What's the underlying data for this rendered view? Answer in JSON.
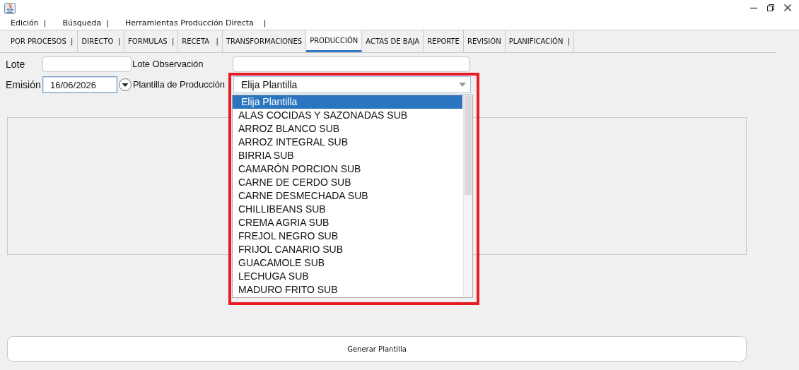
{
  "menu": [
    "Edición  |",
    "Búsqueda  |",
    "Herramientas Producción Directa    |"
  ],
  "tabs": [
    {
      "label": "POR PROCESOS  |",
      "selected": false
    },
    {
      "label": "DIRECTO  |",
      "selected": false
    },
    {
      "label": "FORMULAS  |",
      "selected": false
    },
    {
      "label": "RECETA   |",
      "selected": false
    },
    {
      "label": "TRANSFORMACIONES",
      "selected": false
    },
    {
      "label": "PRODUCCIÓN",
      "selected": true
    },
    {
      "label": "ACTAS DE BAJA",
      "selected": false
    },
    {
      "label": "REPORTE",
      "selected": false
    },
    {
      "label": "REVISIÓN",
      "selected": false
    },
    {
      "label": "PLANIFICACIÓN  |",
      "selected": false
    }
  ],
  "form": {
    "lote_label": "Lote",
    "lote_observacion_label": "Lote Observación",
    "emision_label": "Emisión",
    "emision_value": "16/06/2026",
    "plantilla_label": "Plantilla de Producción",
    "plantilla_value": "Elija Plantilla"
  },
  "dropdown": {
    "highlighted": true,
    "options": [
      {
        "label": "Elija Plantilla",
        "selected": true
      },
      {
        "label": "ALAS COCIDAS Y SAZONADAS SUB",
        "selected": false
      },
      {
        "label": "ARROZ BLANCO SUB",
        "selected": false
      },
      {
        "label": "ARROZ INTEGRAL SUB",
        "selected": false
      },
      {
        "label": "BIRRIA SUB",
        "selected": false
      },
      {
        "label": "CAMARÓN PORCION SUB",
        "selected": false
      },
      {
        "label": "CARNE DE CERDO SUB",
        "selected": false
      },
      {
        "label": "CARNE DESMECHADA SUB",
        "selected": false
      },
      {
        "label": "CHILLIBEANS SUB",
        "selected": false
      },
      {
        "label": "CREMA AGRIA SUB",
        "selected": false
      },
      {
        "label": "FREJOL NEGRO SUB",
        "selected": false
      },
      {
        "label": "FRIJOL CANARIO SUB",
        "selected": false
      },
      {
        "label": "GUACAMOLE SUB",
        "selected": false
      },
      {
        "label": "LECHUGA SUB",
        "selected": false
      },
      {
        "label": "MADURO FRITO SUB",
        "selected": false
      }
    ]
  },
  "button": "Generar Plantilla"
}
